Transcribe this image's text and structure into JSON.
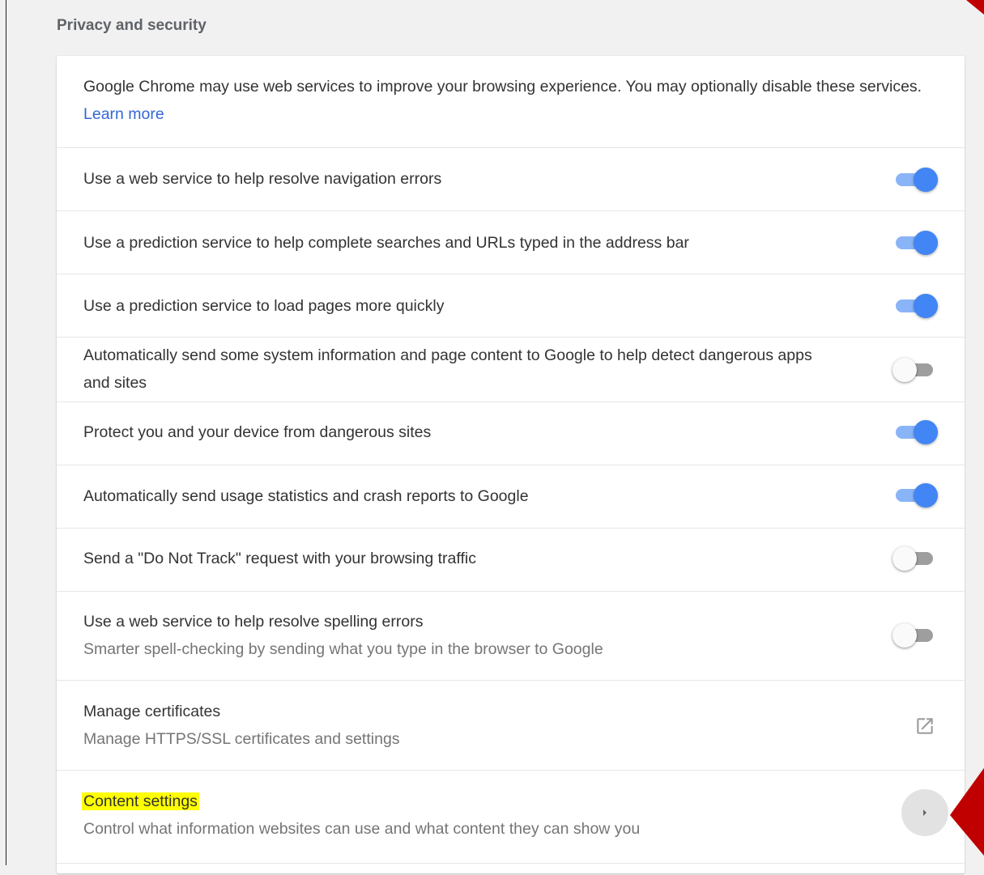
{
  "section": {
    "title": "Privacy and security"
  },
  "intro": {
    "text": "Google Chrome may use web services to improve your browsing experience. You may optionally disable these services.",
    "link": "Learn more"
  },
  "toggles": [
    {
      "label": "Use a web service to help resolve navigation errors",
      "checked": true
    },
    {
      "label": "Use a prediction service to help complete searches and URLs typed in the address bar",
      "checked": true
    },
    {
      "label": "Use a prediction service to load pages more quickly",
      "checked": true
    },
    {
      "label": "Automatically send some system information and page content to Google to help detect dangerous apps and sites",
      "checked": false
    },
    {
      "label": "Protect you and your device from dangerous sites",
      "checked": true
    },
    {
      "label": "Automatically send usage statistics and crash reports to Google",
      "checked": true
    },
    {
      "label": "Send a \"Do Not Track\" request with your browsing traffic",
      "checked": false
    },
    {
      "label": "Use a web service to help resolve spelling errors",
      "sublabel": "Smarter spell-checking by sending what you type in the browser to Google",
      "checked": false
    }
  ],
  "certificates": {
    "label": "Manage certificates",
    "sublabel": "Manage HTTPS/SSL certificates and settings",
    "icon": "external-link-icon"
  },
  "content_settings": {
    "label": "Content settings",
    "sublabel": "Control what information websites can use and what content they can show you",
    "icon": "chevron-right-icon",
    "highlight_color": "#ffff00"
  },
  "colors": {
    "toggle_on_knob": "#4285f4",
    "toggle_on_track": "#8ab4f8",
    "link": "#3367d6",
    "annotation_arrow": "#c00000"
  }
}
